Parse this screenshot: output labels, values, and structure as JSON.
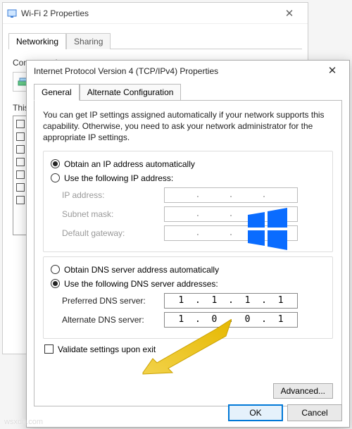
{
  "back_window": {
    "title": "Wi-Fi 2 Properties",
    "tabs": {
      "networking": "Networking",
      "sharing": "Sharing"
    },
    "connect_using_label": "Connect using:",
    "items_label": "This connection uses the following items:"
  },
  "front_window": {
    "title": "Internet Protocol Version 4 (TCP/IPv4) Properties",
    "tabs": {
      "general": "General",
      "alt": "Alternate Configuration"
    },
    "intro": "You can get IP settings assigned automatically if your network supports this capability. Otherwise, you need to ask your network administrator for the appropriate IP settings.",
    "ip": {
      "auto": "Obtain an IP address automatically",
      "manual": "Use the following IP address:",
      "addr_label": "IP address:",
      "mask_label": "Subnet mask:",
      "gw_label": "Default gateway:"
    },
    "dns": {
      "auto": "Obtain DNS server address automatically",
      "manual": "Use the following DNS server addresses:",
      "pref_label": "Preferred DNS server:",
      "alt_label": "Alternate DNS server:",
      "pref_value": [
        "1",
        "1",
        "1",
        "1"
      ],
      "alt_value": [
        "1",
        "0",
        "0",
        "1"
      ]
    },
    "validate": "Validate settings upon exit",
    "advanced": "Advanced...",
    "ok": "OK",
    "cancel": "Cancel"
  },
  "watermark": "wsxdn.com"
}
